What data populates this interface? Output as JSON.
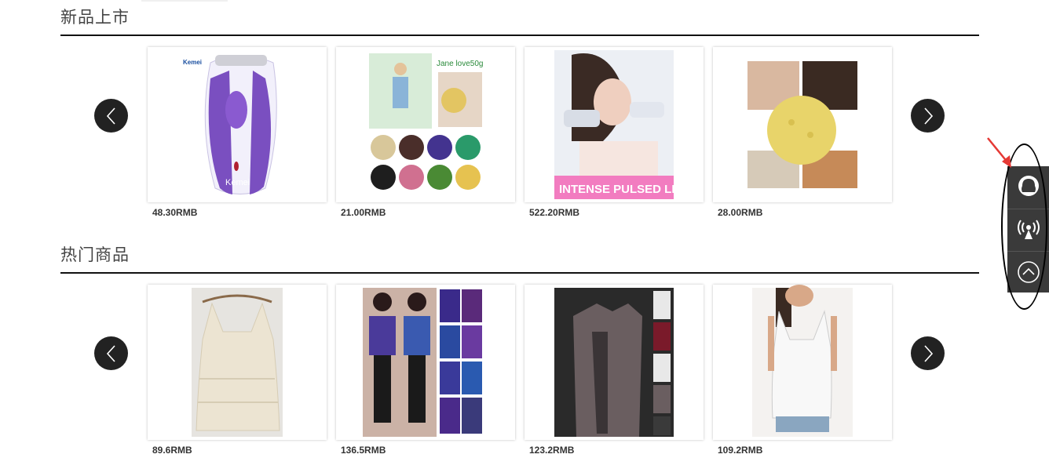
{
  "sections": {
    "new": {
      "title": "新品上市",
      "products": [
        {
          "price": "48.30RMB",
          "image_text": "Kemei"
        },
        {
          "price": "21.00RMB",
          "image_text": "Jane love50g"
        },
        {
          "price": "522.20RMB",
          "image_text": "INTENSE PULSED LIGHT"
        },
        {
          "price": "28.00RMB"
        }
      ]
    },
    "hot": {
      "title": "热门商品",
      "products": [
        {
          "price": "89.6RMB"
        },
        {
          "price": "136.5RMB"
        },
        {
          "price": "123.2RMB"
        },
        {
          "price": "109.2RMB"
        }
      ]
    }
  },
  "sidebar": {
    "items": [
      {
        "icon": "qq-icon"
      },
      {
        "icon": "broadcast-icon"
      },
      {
        "icon": "back-to-top-icon"
      }
    ]
  },
  "colors": {
    "arrow_bg": "#222222",
    "sidebar_bg": "#3a3a3a",
    "annotation_red": "#e53935"
  }
}
